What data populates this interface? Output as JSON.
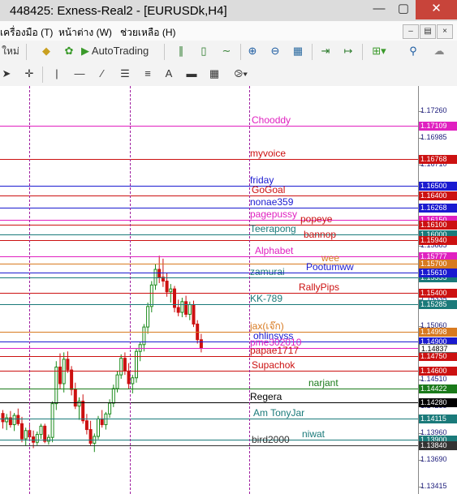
{
  "window": {
    "title": "448425: Exness-Real2 - [EURUSDk,H4]"
  },
  "menu": [
    {
      "label": "เครื่องมือ (T)"
    },
    {
      "label": "หน้าต่าง (W)"
    },
    {
      "label": "ช่วยเหลือ (H)"
    }
  ],
  "toolbar": {
    "new_order_label": "ใหม่",
    "autotrading_label": "AutoTrading"
  },
  "toolbar2": {
    "text_tool": "A"
  },
  "price_scale": {
    "ticks": [
      "1.17260",
      "1.16985",
      "1.16710",
      "1.15885",
      "1.15335",
      "1.15060",
      "1.14510",
      "1.14235",
      "1.13960",
      "1.13690",
      "1.13415"
    ],
    "current_price": "1.14837"
  },
  "level_lines": [
    {
      "name": "Chooddy",
      "price": "1.17109",
      "color": "#e020c0"
    },
    {
      "name": "myvoice",
      "price": "1.16768",
      "color": "#cc1111"
    },
    {
      "name": "friday",
      "price": "1.16500",
      "color": "#1a1ad0"
    },
    {
      "name": "GoGoal",
      "price": "1.16400",
      "color": "#cc1111"
    },
    {
      "name": "nonae359",
      "price": "1.16268",
      "color": "#1a1ad0"
    },
    {
      "name": "pagepussy",
      "price": "1.16150",
      "color": "#e020c0"
    },
    {
      "name": "popeye",
      "price": "1.16100",
      "color": "#cc1111"
    },
    {
      "name": "Teerapong",
      "price": "1.16000",
      "color": "#1a7a7a"
    },
    {
      "name": "bannop",
      "price": "1.15940",
      "color": "#cc1111"
    },
    {
      "name": "Alphabet",
      "price": "1.15777",
      "color": "#e020c0"
    },
    {
      "name": "wee",
      "price": "1.15700",
      "color": "#d87a20"
    },
    {
      "name": "zamurai",
      "price": "1.15555",
      "color": "#1a7a7a"
    },
    {
      "name": "Pootumww",
      "price": "1.15610",
      "color": "#1a1ad0"
    },
    {
      "name": "RallyPips",
      "price": "1.15400",
      "color": "#cc1111"
    },
    {
      "name": "KK-789",
      "price": "1.15285",
      "color": "#1a7a7a"
    },
    {
      "name": "jax(เจ๊ก)",
      "price": "1.14998",
      "color": "#d87a20"
    },
    {
      "name": "ohlinsyss",
      "price": "1.14900",
      "color": "#1a1ad0"
    },
    {
      "name": "pme302010",
      "price": "1.14837",
      "color": "#e020c0"
    },
    {
      "name": "papae1717",
      "price": "1.14750",
      "color": "#cc1111"
    },
    {
      "name": "Supachok",
      "price": "1.14600",
      "color": "#cc1111"
    },
    {
      "name": "narjant",
      "price": "1.14422",
      "color": "#1a7a1a"
    },
    {
      "name": "Regera",
      "price": "1.14280",
      "color": "#000000"
    },
    {
      "name": "Am TonyJar",
      "price": "1.14115",
      "color": "#1a7a7a"
    },
    {
      "name": "niwat",
      "price": "1.13900",
      "color": "#1a7a7a"
    },
    {
      "name": "bird2000",
      "price": "1.13840",
      "color": "#333333"
    }
  ],
  "colors": {
    "bull": "#1a8a1a",
    "bear": "#cc1111",
    "separator": "#a020a0"
  },
  "candles": [
    {
      "o": 1.14165,
      "h": 1.142,
      "l": 1.1401,
      "c": 1.1408
    },
    {
      "o": 1.1408,
      "h": 1.1416,
      "l": 1.13995,
      "c": 1.1412
    },
    {
      "o": 1.1412,
      "h": 1.1419,
      "l": 1.1402,
      "c": 1.1405
    },
    {
      "o": 1.1405,
      "h": 1.1417,
      "l": 1.13985,
      "c": 1.14145
    },
    {
      "o": 1.14145,
      "h": 1.14215,
      "l": 1.1404,
      "c": 1.1406
    },
    {
      "o": 1.1406,
      "h": 1.1413,
      "l": 1.1387,
      "c": 1.13905
    },
    {
      "o": 1.13905,
      "h": 1.1402,
      "l": 1.1383,
      "c": 1.1399
    },
    {
      "o": 1.1399,
      "h": 1.1407,
      "l": 1.139,
      "c": 1.13925
    },
    {
      "o": 1.13925,
      "h": 1.1399,
      "l": 1.1381,
      "c": 1.1387
    },
    {
      "o": 1.1387,
      "h": 1.1398,
      "l": 1.1384,
      "c": 1.1395
    },
    {
      "o": 1.1395,
      "h": 1.1406,
      "l": 1.13905,
      "c": 1.14035
    },
    {
      "o": 1.14035,
      "h": 1.1406,
      "l": 1.1386,
      "c": 1.1388
    },
    {
      "o": 1.1388,
      "h": 1.1395,
      "l": 1.13845,
      "c": 1.1392
    },
    {
      "o": 1.1392,
      "h": 1.1429,
      "l": 1.1387,
      "c": 1.14265
    },
    {
      "o": 1.14265,
      "h": 1.147,
      "l": 1.142,
      "c": 1.1464
    },
    {
      "o": 1.1464,
      "h": 1.1478,
      "l": 1.1442,
      "c": 1.1447
    },
    {
      "o": 1.1447,
      "h": 1.1479,
      "l": 1.1438,
      "c": 1.1472
    },
    {
      "o": 1.1472,
      "h": 1.148,
      "l": 1.1458,
      "c": 1.1461
    },
    {
      "o": 1.1461,
      "h": 1.1465,
      "l": 1.1435,
      "c": 1.1441
    },
    {
      "o": 1.1441,
      "h": 1.1448,
      "l": 1.1421,
      "c": 1.1424
    },
    {
      "o": 1.1424,
      "h": 1.1433,
      "l": 1.141,
      "c": 1.1429
    },
    {
      "o": 1.1429,
      "h": 1.1436,
      "l": 1.1406,
      "c": 1.1409
    },
    {
      "o": 1.1409,
      "h": 1.1416,
      "l": 1.1395,
      "c": 1.14
    },
    {
      "o": 1.14,
      "h": 1.1409,
      "l": 1.1383,
      "c": 1.1386
    },
    {
      "o": 1.1386,
      "h": 1.1396,
      "l": 1.1377,
      "c": 1.1393
    },
    {
      "o": 1.1393,
      "h": 1.1414,
      "l": 1.139,
      "c": 1.1411
    },
    {
      "o": 1.1411,
      "h": 1.142,
      "l": 1.1402,
      "c": 1.1405
    },
    {
      "o": 1.1405,
      "h": 1.1418,
      "l": 1.14,
      "c": 1.1416
    },
    {
      "o": 1.1416,
      "h": 1.1431,
      "l": 1.1412,
      "c": 1.1427
    },
    {
      "o": 1.1427,
      "h": 1.1446,
      "l": 1.1423,
      "c": 1.1442
    },
    {
      "o": 1.1442,
      "h": 1.146,
      "l": 1.1438,
      "c": 1.1456
    },
    {
      "o": 1.1456,
      "h": 1.1477,
      "l": 1.1452,
      "c": 1.1473
    },
    {
      "o": 1.1473,
      "h": 1.1479,
      "l": 1.1456,
      "c": 1.146
    },
    {
      "o": 1.146,
      "h": 1.1468,
      "l": 1.1442,
      "c": 1.1447
    },
    {
      "o": 1.1447,
      "h": 1.1456,
      "l": 1.1437,
      "c": 1.1453
    },
    {
      "o": 1.1453,
      "h": 1.1483,
      "l": 1.1448,
      "c": 1.148
    },
    {
      "o": 1.148,
      "h": 1.149,
      "l": 1.147,
      "c": 1.1487
    },
    {
      "o": 1.1487,
      "h": 1.1508,
      "l": 1.148,
      "c": 1.1505
    },
    {
      "o": 1.1505,
      "h": 1.153,
      "l": 1.1498,
      "c": 1.1526
    },
    {
      "o": 1.1526,
      "h": 1.1552,
      "l": 1.152,
      "c": 1.1548
    },
    {
      "o": 1.1548,
      "h": 1.1569,
      "l": 1.1543,
      "c": 1.1564
    },
    {
      "o": 1.1564,
      "h": 1.1578,
      "l": 1.155,
      "c": 1.1556
    },
    {
      "o": 1.1556,
      "h": 1.1575,
      "l": 1.1546,
      "c": 1.1552
    },
    {
      "o": 1.1552,
      "h": 1.156,
      "l": 1.1536,
      "c": 1.1541
    },
    {
      "o": 1.1541,
      "h": 1.1549,
      "l": 1.153,
      "c": 1.1544
    },
    {
      "o": 1.1544,
      "h": 1.1547,
      "l": 1.152,
      "c": 1.1525
    },
    {
      "o": 1.1525,
      "h": 1.1533,
      "l": 1.1516,
      "c": 1.152
    },
    {
      "o": 1.152,
      "h": 1.1535,
      "l": 1.1515,
      "c": 1.1531
    },
    {
      "o": 1.1531,
      "h": 1.1537,
      "l": 1.1515,
      "c": 1.1518
    },
    {
      "o": 1.1518,
      "h": 1.1531,
      "l": 1.1512,
      "c": 1.1528
    },
    {
      "o": 1.1528,
      "h": 1.1532,
      "l": 1.1505,
      "c": 1.1508
    },
    {
      "o": 1.1508,
      "h": 1.1512,
      "l": 1.1488,
      "c": 1.1492
    },
    {
      "o": 1.1492,
      "h": 1.1498,
      "l": 1.1479,
      "c": 1.14837
    }
  ]
}
